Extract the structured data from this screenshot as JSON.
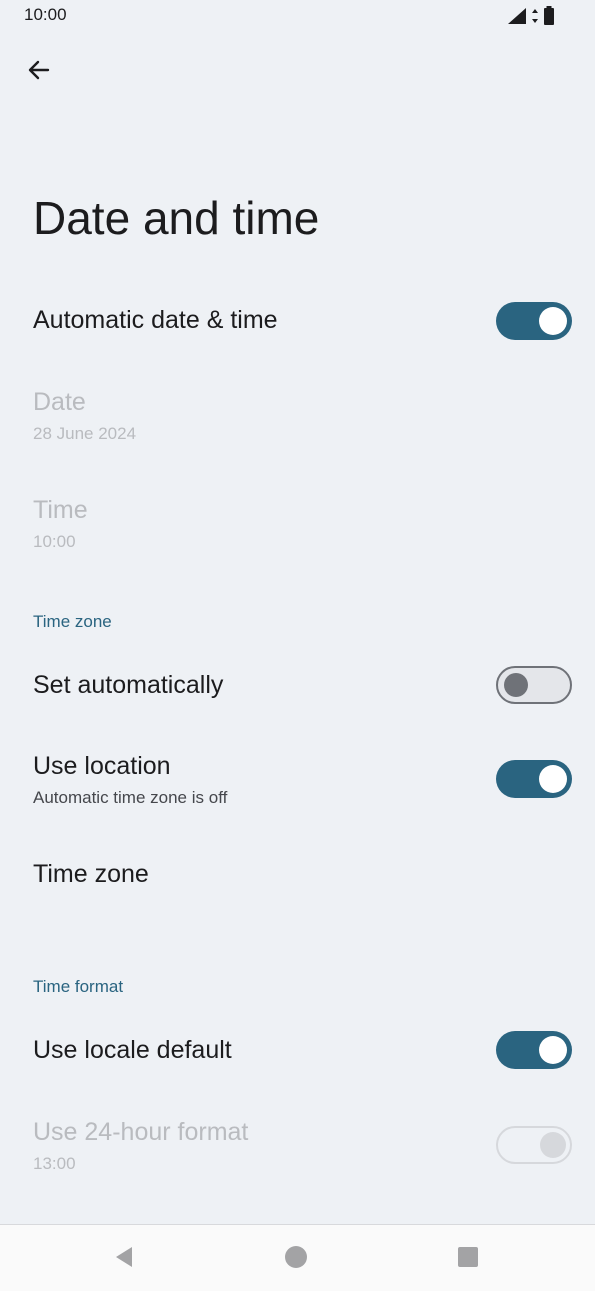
{
  "status_bar": {
    "time": "10:00",
    "icons": [
      "signal-icon",
      "data-arrows-icon",
      "battery-icon"
    ]
  },
  "header": {
    "back_icon": "arrow-left-icon",
    "title": "Date and time"
  },
  "rows": {
    "auto_date_time": {
      "title": "Automatic date & time",
      "switch": "on"
    },
    "date": {
      "title": "Date",
      "summary": "28 June 2024",
      "enabled": false
    },
    "time": {
      "title": "Time",
      "summary": "10:00",
      "enabled": false
    },
    "set_automatically": {
      "title": "Set automatically",
      "switch": "off"
    },
    "use_location": {
      "title": "Use location",
      "summary": "Automatic time zone is off",
      "switch": "on"
    },
    "time_zone": {
      "title": "Time zone"
    },
    "use_locale_default": {
      "title": "Use locale default",
      "switch": "on"
    },
    "use_24_hour": {
      "title": "Use 24-hour format",
      "summary": "13:00",
      "switch": "on",
      "enabled": false
    }
  },
  "sections": {
    "time_zone": "Time zone",
    "time_format": "Time format"
  },
  "nav_bar": {
    "icons": [
      "back-triangle-icon",
      "home-circle-icon",
      "recents-square-icon"
    ]
  },
  "colors": {
    "accent": "#2a6480",
    "background": "#eef1f5",
    "disabled_text": "#b9bbbf"
  }
}
